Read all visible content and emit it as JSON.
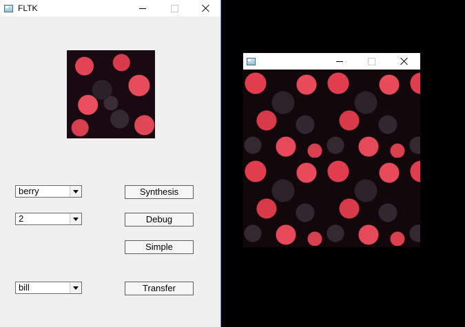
{
  "main_window": {
    "title": "FLTK"
  },
  "controls": {
    "texture_select": "berry",
    "level_select": "2",
    "transfer_select": "bill",
    "synthesis_label": "Synthesis",
    "debug_label": "Debug",
    "simple_label": "Simple",
    "transfer_label": "Transfer"
  },
  "image_window": {
    "title": ""
  },
  "icons": {
    "app": "window-app-icon",
    "minimize": "minimize-icon",
    "maximize": "maximize-icon",
    "close": "close-icon",
    "dropdown": "chevron-down-icon"
  }
}
